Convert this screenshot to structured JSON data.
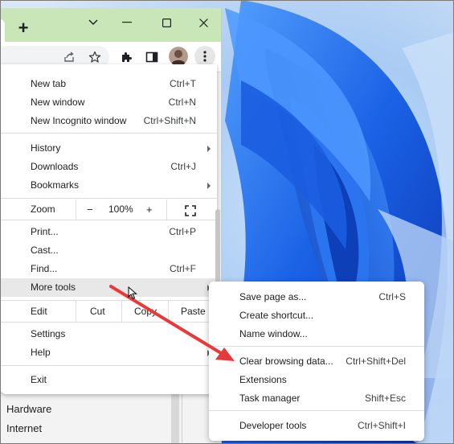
{
  "colors": {
    "titlebar": "#c8e6b8",
    "menu_bg": "#ffffff",
    "highlight": "#e8e8e8",
    "arrow": "#e8393b",
    "wallpaper": "#0a47c9"
  },
  "window": {
    "new_tab_label": "+",
    "tab_search_icon": "chevron-down-icon",
    "minimize_icon": "minimize-icon",
    "maximize_icon": "maximize-icon",
    "close_icon": "close-icon"
  },
  "toolbar": {
    "icons": [
      "share-icon",
      "bookmark-star-icon",
      "extensions-icon",
      "side-panel-icon",
      "profile-avatar",
      "kebab-menu-icon"
    ]
  },
  "page": {
    "links": [
      "Hardware",
      "Internet"
    ]
  },
  "main_menu": {
    "new_tab": {
      "label": "New tab",
      "shortcut": "Ctrl+T"
    },
    "new_window": {
      "label": "New window",
      "shortcut": "Ctrl+N"
    },
    "new_incognito": {
      "label": "New Incognito window",
      "shortcut": "Ctrl+Shift+N"
    },
    "history": {
      "label": "History"
    },
    "downloads": {
      "label": "Downloads",
      "shortcut": "Ctrl+J"
    },
    "bookmarks": {
      "label": "Bookmarks"
    },
    "zoom": {
      "label": "Zoom",
      "minus": "−",
      "value": "100%",
      "plus": "+"
    },
    "print": {
      "label": "Print...",
      "shortcut": "Ctrl+P"
    },
    "cast": {
      "label": "Cast..."
    },
    "find": {
      "label": "Find...",
      "shortcut": "Ctrl+F"
    },
    "more_tools": {
      "label": "More tools"
    },
    "edit": {
      "label": "Edit",
      "cut": "Cut",
      "copy": "Copy",
      "paste": "Paste"
    },
    "settings": {
      "label": "Settings"
    },
    "help": {
      "label": "Help"
    },
    "exit": {
      "label": "Exit"
    }
  },
  "more_tools_menu": {
    "save_page": {
      "label": "Save page as...",
      "shortcut": "Ctrl+S"
    },
    "create_shortcut": {
      "label": "Create shortcut..."
    },
    "name_window": {
      "label": "Name window..."
    },
    "clear_browsing": {
      "label": "Clear browsing data...",
      "shortcut": "Ctrl+Shift+Del"
    },
    "extensions": {
      "label": "Extensions"
    },
    "task_manager": {
      "label": "Task manager",
      "shortcut": "Shift+Esc"
    },
    "developer_tools": {
      "label": "Developer tools",
      "shortcut": "Ctrl+Shift+I"
    }
  }
}
